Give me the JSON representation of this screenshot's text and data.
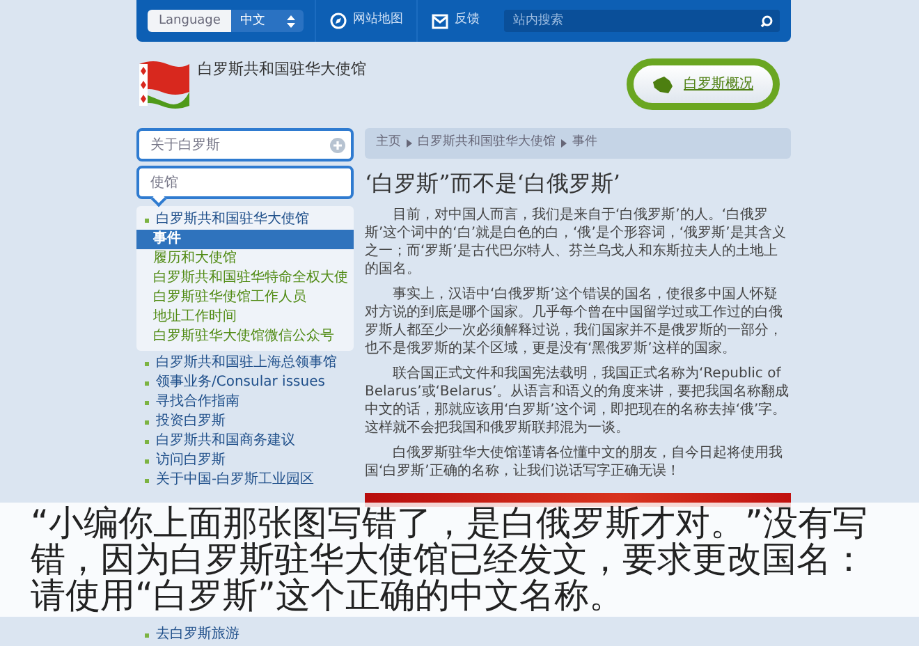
{
  "top_bar": {
    "language_label": "Language",
    "language_value": "中文",
    "links": [
      {
        "label": "网站地图",
        "kind": "sitemap"
      },
      {
        "label": "反馈",
        "kind": "mail"
      }
    ],
    "search": {
      "placeholder": "站内搜索"
    }
  },
  "header": {
    "title": "白罗斯共和国驻华大使馆",
    "button": "白罗斯概况"
  },
  "sidebar": {
    "sections": [
      {
        "label": "关于白罗斯",
        "expanded": false
      },
      {
        "label": "使馆",
        "expanded": true
      }
    ],
    "items": [
      {
        "label": "白罗斯共和国驻华大使馆",
        "children": [
          {
            "label": "事件",
            "selected": true
          },
          {
            "label": "履历和大使馆",
            "selected": false
          },
          {
            "label": "白罗斯共和国驻华特命全权大使",
            "selected": false
          },
          {
            "label": "白罗斯驻华使馆工作人员",
            "selected": false
          },
          {
            "label": "地址工作时间",
            "selected": false
          },
          {
            "label": "白罗斯驻华大使馆微信公众号",
            "selected": false
          }
        ]
      },
      {
        "label": "白罗斯共和国驻上海总领事馆"
      },
      {
        "label": "领事业务/Consular issues"
      },
      {
        "label": "寻找合作指南"
      },
      {
        "label": "投资白罗斯"
      },
      {
        "label": "白罗斯共和国商务建议"
      },
      {
        "label": "访问白罗斯"
      },
      {
        "label": "关于中国-白罗斯工业园区"
      }
    ],
    "bottom_item": "去白罗斯旅游"
  },
  "article": {
    "breadcrumb": [
      "主页",
      "白罗斯共和国驻华大使馆",
      "事件"
    ],
    "title": "‘白罗斯”而不是‘白俄罗斯’",
    "paragraphs": [
      "目前，对中国人而言，我们是来自于‘白俄罗斯’的人。‘白俄罗斯’这个词中的‘白’就是白色的白，‘俄’是个形容词，‘俄罗斯’是其含义之一；而‘罗斯’是古代巴尔特人、芬兰乌戈人和东斯拉夫人的土地上的国名。",
      "事实上，汉语中‘白俄罗斯’这个错误的国名，使很多中国人怀疑对方说的到底是哪个国家。几乎每个曾在中国留学过或工作过的白俄罗斯人都至少一次必须解释过说，我们国家并不是俄罗斯的一部分，也不是俄罗斯的某个区域，更是没有‘黑俄罗斯’这样的国家。",
      "联合国正式文件和我国宪法载明，我国正式名称为‘Republic of Belarus’或‘Belarus’。从语言和语义的角度来讲，要把我国名称翻成中文的话，那就应该用‘白罗斯’这个词，即把现在的名称去掉‘俄’字。这样就不会把我国和俄罗斯联邦混为一谈。",
      "白俄罗斯驻华大使馆谨请各位懂中文的朋友，自今日起将使用我国‘白罗斯’正确的名称，让我们说话写字正确无误！"
    ]
  },
  "caption": "“小编你上面那张图写错了，是白俄罗斯才对。”没有写错，因为白罗斯驻华大使馆已经发文，要求更改国名：请使用“白罗斯”这个正确的中文名称。"
}
